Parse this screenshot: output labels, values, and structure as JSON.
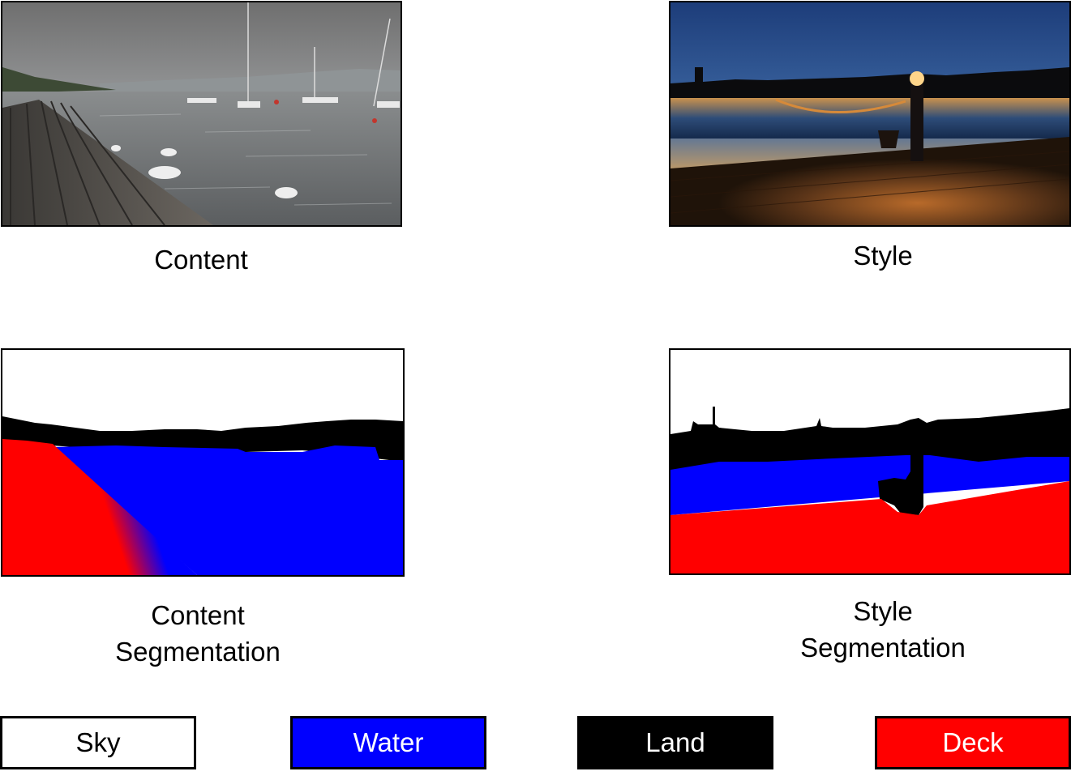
{
  "captions": {
    "content": "Content",
    "style": "Style",
    "content_segmentation": [
      "Content",
      "Segmentation"
    ],
    "style_segmentation": [
      "Style",
      "Segmentation"
    ]
  },
  "legend": [
    {
      "label": "Sky",
      "fill": "#ffffff",
      "text_color": "#000000"
    },
    {
      "label": "Water",
      "fill": "#0000ff",
      "text_color": "#ffffff"
    },
    {
      "label": "Land",
      "fill": "#000000",
      "text_color": "#ffffff"
    },
    {
      "label": "Deck",
      "fill": "#ff0000",
      "text_color": "#ffffff"
    }
  ],
  "colors": {
    "sky": "#ffffff",
    "water": "#0000ff",
    "land": "#000000",
    "deck": "#ff0000"
  }
}
